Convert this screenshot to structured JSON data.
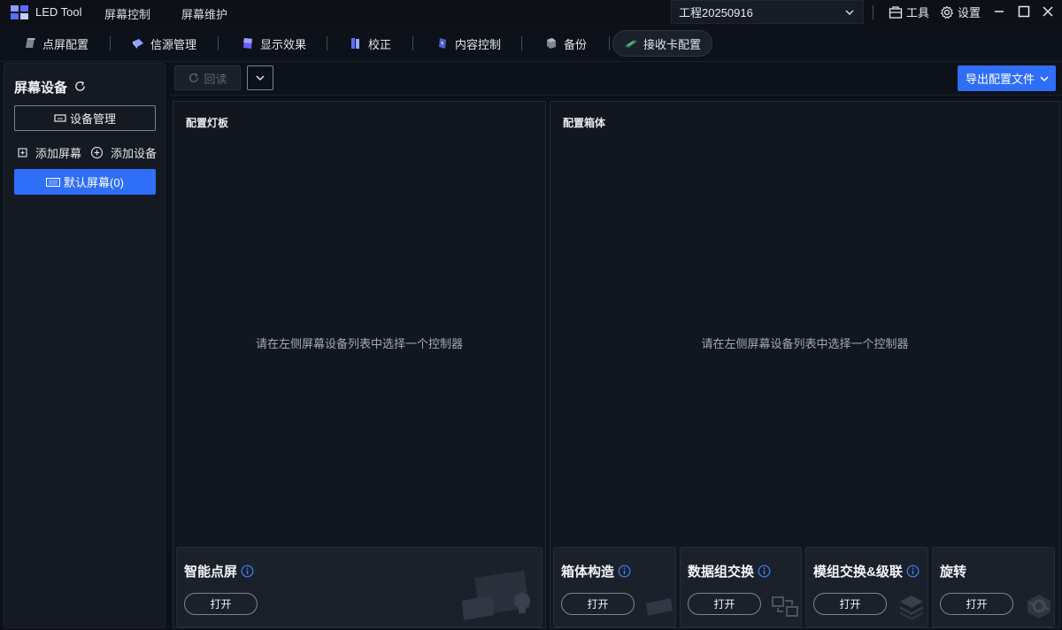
{
  "titlebar": {
    "app_title": "LED Tool",
    "menu": [
      "屏幕控制",
      "屏幕维护"
    ],
    "project": "工程20250916",
    "tools_label": "工具",
    "settings_label": "设置"
  },
  "tabs": [
    {
      "label": "点屏配置"
    },
    {
      "label": "信源管理"
    },
    {
      "label": "显示效果"
    },
    {
      "label": "校正"
    },
    {
      "label": "内容控制"
    },
    {
      "label": "备份"
    },
    {
      "label": "接收卡配置",
      "active": true
    }
  ],
  "sidebar": {
    "title": "屏幕设备",
    "device_mgmt": "设备管理",
    "add_screen": "添加屏幕",
    "add_device": "添加设备",
    "screen_item": "默认屏幕(0)"
  },
  "toolbar": {
    "readback": "回读",
    "export": "导出配置文件"
  },
  "panels": {
    "left": {
      "title": "配置灯板",
      "empty": "请在左侧屏幕设备列表中选择一个控制器"
    },
    "right": {
      "title": "配置箱体",
      "empty": "请在左侧屏幕设备列表中选择一个控制器"
    }
  },
  "cards": [
    {
      "title": "智能点屏",
      "button": "打开"
    },
    {
      "title": "箱体构造",
      "button": "打开"
    },
    {
      "title": "数据组交换",
      "button": "打开"
    },
    {
      "title": "模组交换&级联",
      "button": "打开"
    },
    {
      "title": "旋转",
      "button": "打开"
    }
  ],
  "colors": {
    "accent": "#2f6ef6",
    "background": "#0d1119",
    "panel": "#12161e",
    "info": "#3b82f6"
  }
}
